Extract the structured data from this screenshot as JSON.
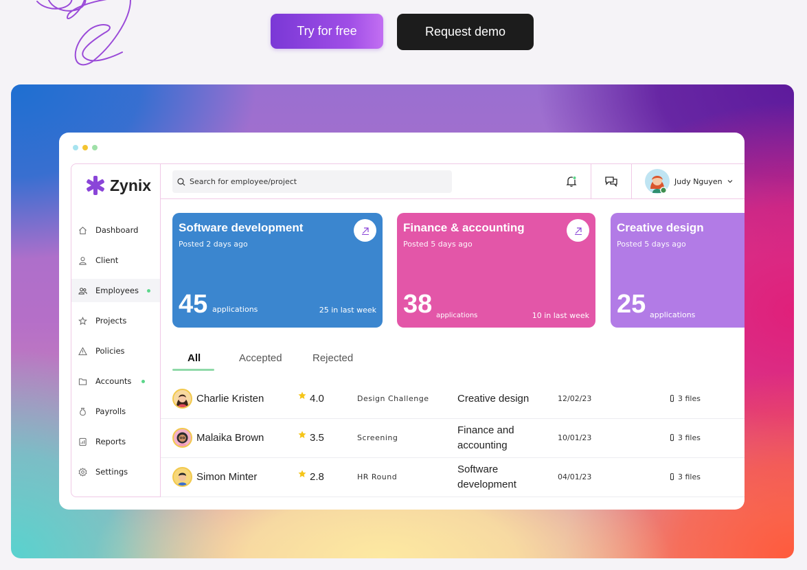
{
  "cta": {
    "try_label": "Try for free",
    "demo_label": "Request demo"
  },
  "colors": {
    "try_gradient": [
      "#7a38d6",
      "#c26ff2"
    ],
    "demo_bg": "#1c1c1c",
    "card_software": "#3b86cf",
    "card_finance": "#e356a8",
    "card_creative": "#b27be6",
    "accent_purple": "#8a45d8",
    "status_green": "#5cd68a",
    "window_dots": [
      "#a6e3ef",
      "#f4c430",
      "#9fe0a8"
    ]
  },
  "app": {
    "name": "Zynix"
  },
  "sidebar": {
    "items": [
      {
        "label": "Dashboard",
        "icon": "home-icon",
        "active": false,
        "dot": false
      },
      {
        "label": "Client",
        "icon": "user-icon",
        "active": false,
        "dot": false
      },
      {
        "label": "Employees",
        "icon": "users-icon",
        "active": true,
        "dot": true
      },
      {
        "label": "Projects",
        "icon": "star-outline-icon",
        "active": false,
        "dot": false
      },
      {
        "label": "Policies",
        "icon": "warning-icon",
        "active": false,
        "dot": false
      },
      {
        "label": "Accounts",
        "icon": "folder-icon",
        "active": false,
        "dot": true
      },
      {
        "label": "Payrolls",
        "icon": "money-bag-icon",
        "active": false,
        "dot": false
      },
      {
        "label": "Reports",
        "icon": "report-icon",
        "active": false,
        "dot": false
      },
      {
        "label": "Settings",
        "icon": "gear-icon",
        "active": false,
        "dot": false
      }
    ]
  },
  "topbar": {
    "search_placeholder": "Search for employee/project",
    "user_name": "Judy Nguyen"
  },
  "cards": [
    {
      "title": "Software development",
      "posted": "Posted 2 days ago",
      "count": "45",
      "count_label": "applications",
      "last_week": "25 in last week"
    },
    {
      "title": "Finance & accounting",
      "posted": "Posted 5 days ago",
      "count": "38",
      "count_label": "applications",
      "last_week": "10 in last week"
    },
    {
      "title": "Creative design",
      "posted": "Posted 5 days ago",
      "count": "25",
      "count_label": "applications"
    }
  ],
  "tabs": [
    {
      "label": "All",
      "active": true
    },
    {
      "label": "Accepted",
      "active": false
    },
    {
      "label": "Rejected",
      "active": false
    }
  ],
  "rows": [
    {
      "name": "Charlie Kristen",
      "rating": "4.0",
      "stage": "Design Challenge",
      "department": "Creative design",
      "date": "12/02/23",
      "files": "3 files"
    },
    {
      "name": "Malaika Brown",
      "rating": "3.5",
      "stage": "Screening",
      "department": "Finance and accounting",
      "date": "10/01/23",
      "files": "3 files"
    },
    {
      "name": "Simon Minter",
      "rating": "2.8",
      "stage": "HR Round",
      "department": "Software development",
      "date": "04/01/23",
      "files": "3 files"
    }
  ]
}
